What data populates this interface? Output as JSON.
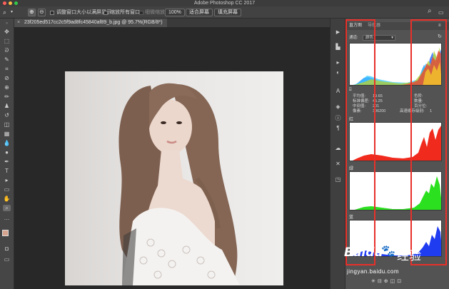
{
  "app": {
    "title": "Adobe Photoshop CC 2017"
  },
  "options_bar": {
    "resize_windows_label": "调整窗口大小以满屏显示",
    "zoom_all_label": "缩放所有窗口",
    "scrubby_zoom_label": "细微缩放",
    "zoom_percent": "100%",
    "fit_screen_label": "适合屏幕",
    "fill_screen_label": "填充屏幕"
  },
  "document": {
    "tab_title": "23f205ed517cc2c5f9ad8fc45840af89_b.jpg @ 95.7%(RGB/8*)"
  },
  "panel": {
    "tabs": [
      "直方图",
      "导航器"
    ],
    "channel_label": "通道:",
    "channel_value": "颜色",
    "stats_left": [
      {
        "label": "平均值:",
        "value": "19.65"
      },
      {
        "label": "标准偏差:",
        "value": "45.25"
      },
      {
        "label": "中间值:",
        "value": "201"
      },
      {
        "label": "像素:",
        "value": "306200"
      }
    ],
    "stats_right": [
      {
        "label": "色阶:",
        "value": ""
      },
      {
        "label": "数量:",
        "value": ""
      },
      {
        "label": "百分位:",
        "value": ""
      },
      {
        "label": "高速缓存级别:",
        "value": "1"
      }
    ],
    "channels": [
      "红",
      "绿",
      "蓝"
    ]
  },
  "watermark": {
    "brand": "Baidu",
    "brand_cn": "经验",
    "url": "jingyan.baidu.com"
  },
  "colors": {
    "accent_red": "#e8302a",
    "panel_bg": "#535353",
    "canvas_bg": "#282828"
  }
}
